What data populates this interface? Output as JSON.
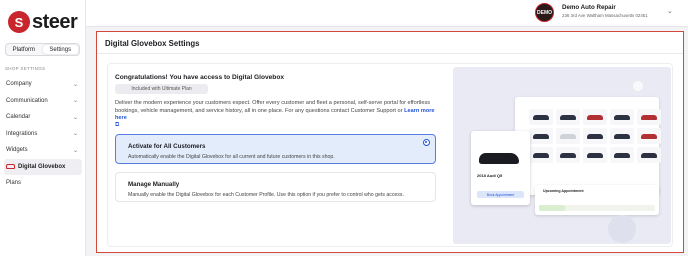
{
  "brand": {
    "name": "steer",
    "badge": "S"
  },
  "toggle": {
    "left": "Platform",
    "right": "Settings"
  },
  "sidebar": {
    "section_label": "SHOP SETTINGS",
    "items": [
      {
        "label": "Company",
        "chevron": "⌄"
      },
      {
        "label": "Communication",
        "chevron": "⌄"
      },
      {
        "label": "Calendar",
        "chevron": "⌄"
      },
      {
        "label": "Integrations",
        "chevron": "⌄"
      },
      {
        "label": "Widgets",
        "chevron": "⌄"
      },
      {
        "label": "Digital Glovebox",
        "chevron": ""
      },
      {
        "label": "Plans",
        "chevron": ""
      }
    ]
  },
  "header": {
    "shop_logo_text": "DEMO",
    "shop_name": "Demo Auto Repair",
    "shop_address": "236 3rd Ave Waltham Massachusetts 02451",
    "dropdown_icon": "chevron-down"
  },
  "main": {
    "title": "Digital Glovebox Settings",
    "headline": "Congratulations! You have access to Digital Glovebox",
    "plan_badge": "Included with Ultimate Plan",
    "description": "Deliver the modern experience your customers expect. Offer every customer and fleet a personal, self-serve portal for effortless bookings, vehicle management, and service history, all in one place. For any questions contact Customer Support or",
    "learn_more": "Learn more here",
    "options": [
      {
        "title": "Activate for All Customers",
        "desc": "Automatically enable the Digital Glovebox for all current and future customers in this shop.",
        "selected": true
      },
      {
        "title": "Manage Manually",
        "desc": "Manually enable the Digital Glovebox for each Customer Profile. Use this option if you prefer to control who gets access.",
        "selected": false
      }
    ]
  },
  "preview": {
    "car_title": "2018 Audi Q5",
    "button": "Book Appointment",
    "upcoming": "Upcoming Appointment"
  },
  "colors": {
    "brand_red": "#c8252c",
    "accent_blue": "#2454d8",
    "selected_bg": "#e3ecfb"
  }
}
